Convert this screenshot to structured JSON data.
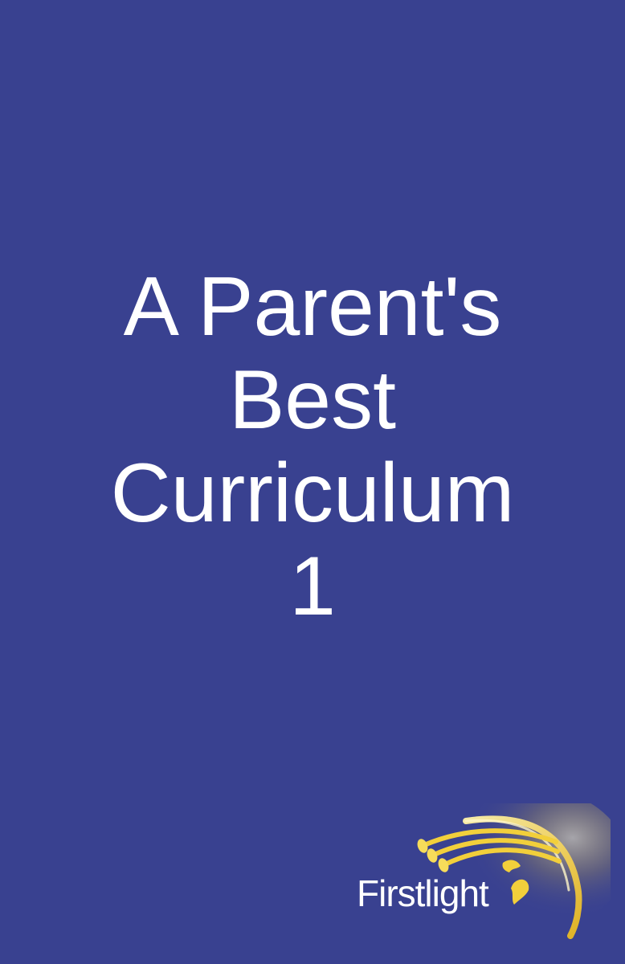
{
  "cover": {
    "background_color": "#394190",
    "title_lines": [
      "A Parent's",
      "Best",
      "Curriculum",
      "1"
    ],
    "text_color": "#ffffff"
  },
  "logo": {
    "text": "Firstlight",
    "accent_color": "#f2cf3b",
    "icon": "swoosh-beams-icon"
  }
}
